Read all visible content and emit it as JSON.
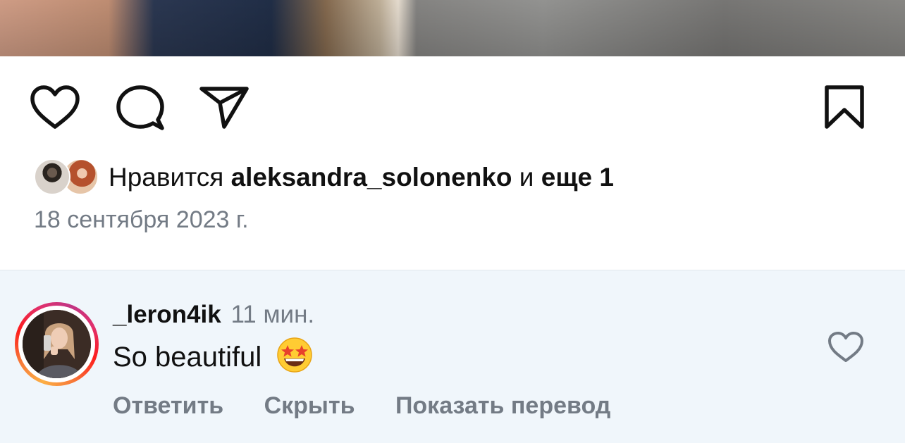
{
  "post": {
    "photo_alt": "",
    "likes": {
      "prefix": "Нравится",
      "user": "aleksandra_solonenko",
      "connector": "и",
      "more": "еще 1"
    },
    "date": "18 сентября 2023 г."
  },
  "actions": {
    "icons": [
      "heart-icon",
      "comment-icon",
      "share-icon",
      "bookmark-icon"
    ]
  },
  "comment": {
    "username": "_leron4ik",
    "time": "11 мин.",
    "text": "So beautiful",
    "emoji": "🤩",
    "reply_label": "Ответить",
    "hide_label": "Скрыть",
    "translate_label": "Показать перевод"
  },
  "colors": {
    "text": "#111111",
    "secondary": "#737b85",
    "comment_bg": "#f0f6fb"
  }
}
